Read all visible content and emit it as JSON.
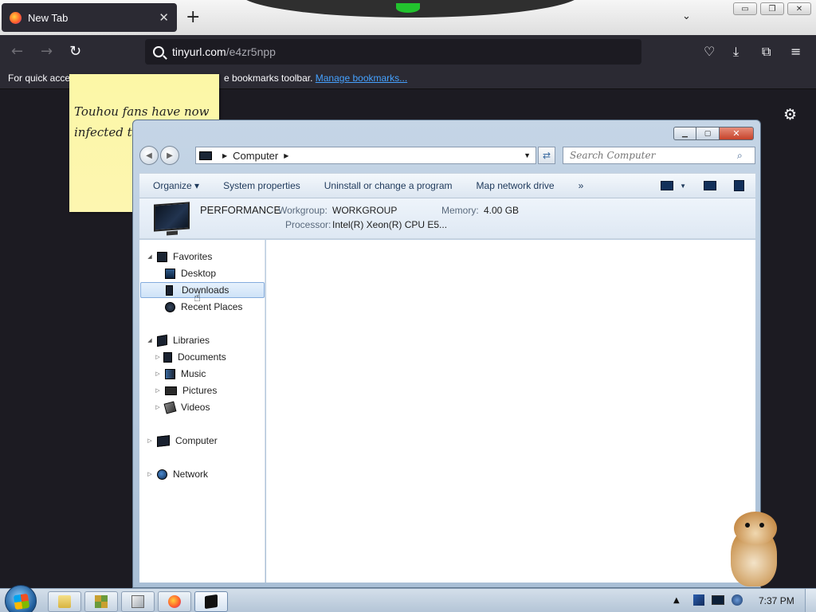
{
  "browser": {
    "tab": {
      "title": "New Tab",
      "close_glyph": "✕"
    },
    "new_tab_glyph": "+",
    "list_tabs_glyph": "⌄",
    "window_buttons": {
      "minimize": "▭",
      "restore": "❐",
      "close": "✕"
    },
    "nav": {
      "back": "←",
      "forward": "→",
      "reload": "↻"
    },
    "url": {
      "host": "tinyurl.com",
      "path": "/e4zr5npp"
    },
    "right_icons": {
      "pocket": "♡",
      "downloads": "⤓",
      "extensions": "⧉",
      "menu": "≡"
    },
    "bookmarks_bar": {
      "message_start": "For quick acce",
      "message_end": "e bookmarks toolbar. ",
      "link": "Manage bookmarks..."
    },
    "settings_glyph": "⚙"
  },
  "sticky_note": {
    "line1": "Touhou fans have now",
    "line2": "infected t"
  },
  "explorer": {
    "controls": {
      "minimize": "▁",
      "maximize": "▢",
      "close": "✕"
    },
    "back_glyph": "◀",
    "forward_glyph": "▶",
    "address": {
      "location": "Computer",
      "sep": "▶",
      "drop": "▼"
    },
    "refresh_glyph": "⇄",
    "search_placeholder": "Search Computer",
    "search_glyph": "⌕",
    "toolbar": {
      "organize": "Organize ▾",
      "system_properties": "System properties",
      "uninstall": "Uninstall or change a program",
      "map_drive": "Map network drive",
      "more": "»",
      "view_drop": "▼"
    },
    "details": {
      "name": "PERFORMANCE",
      "workgroup_label": "Workgroup:",
      "workgroup_value": "WORKGROUP",
      "memory_label": "Memory:",
      "memory_value": "4.00 GB",
      "processor_label": "Processor:",
      "processor_value": "Intel(R) Xeon(R) CPU E5..."
    },
    "nav": {
      "expanded": "◢",
      "collapsed": "▷",
      "items": [
        {
          "label": "Favorites"
        },
        {
          "label": "Desktop"
        },
        {
          "label": "Downloads"
        },
        {
          "label": "Recent Places"
        },
        {
          "label": "Libraries"
        },
        {
          "label": "Documents"
        },
        {
          "label": "Music"
        },
        {
          "label": "Pictures"
        },
        {
          "label": "Videos"
        },
        {
          "label": "Computer"
        },
        {
          "label": "Network"
        }
      ]
    },
    "cursor_glyph": "☝"
  },
  "taskbar": {
    "tray_arrow": "▲",
    "clock": "7:37 PM"
  },
  "colors": {
    "browser_bg": "#1c1b22",
    "toolbar_bg": "#2b2a33",
    "link": "#45a1ff",
    "sticky": "#fdf6b0",
    "explorer_frame": "#b7c9dc",
    "selection": "#cfe3f8"
  }
}
